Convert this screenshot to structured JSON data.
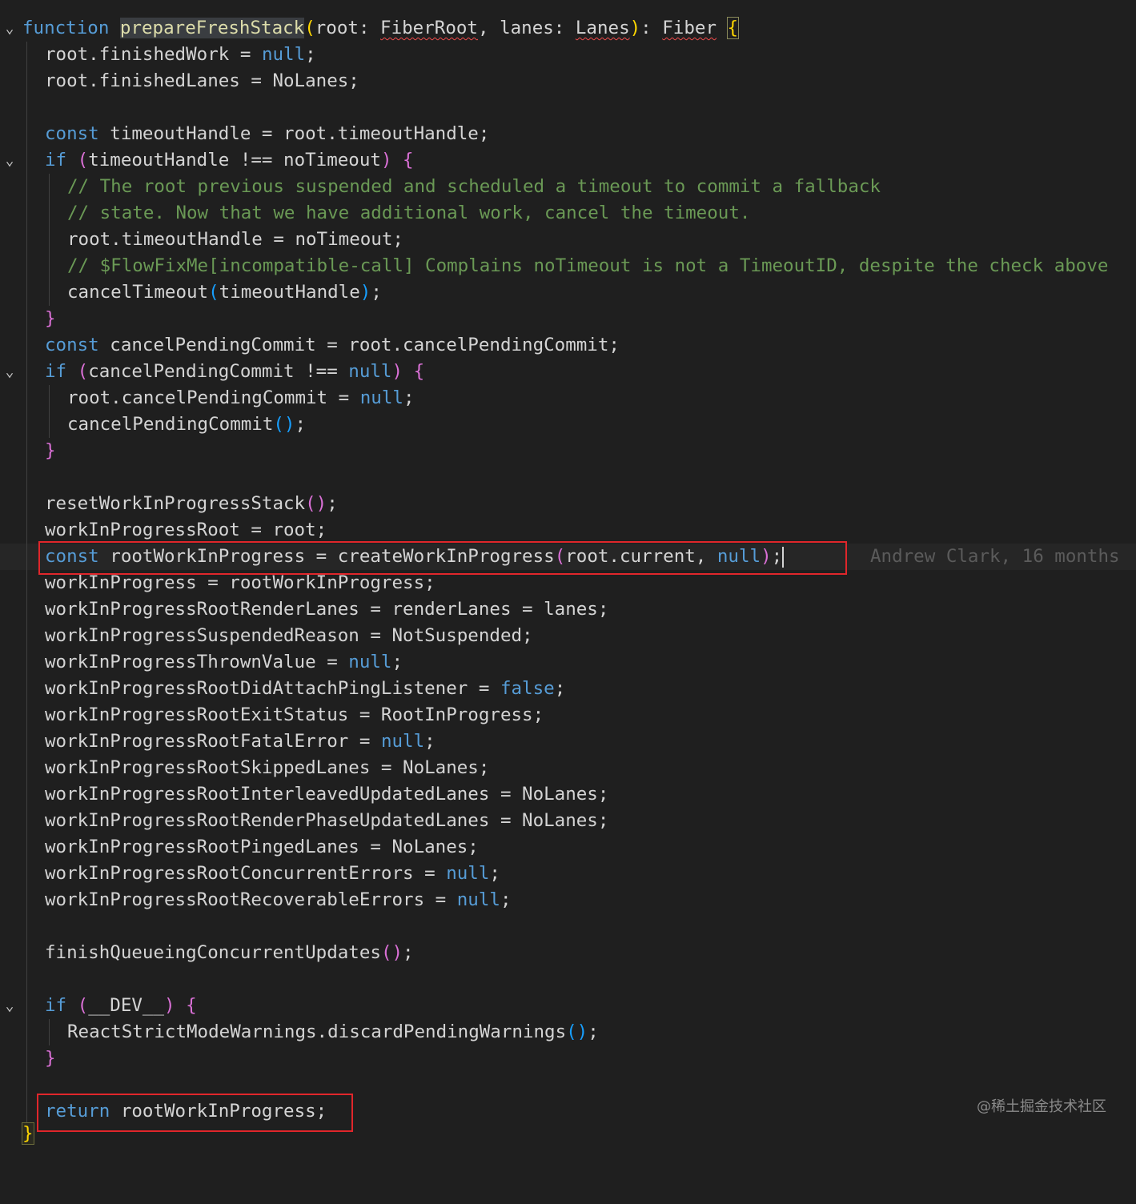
{
  "editor": {
    "lines": {
      "l1": {
        "kw": "function",
        "fn": "prepareFreshStack",
        "p1": "(",
        "a1": "root",
        "c1": ": ",
        "t1": "FiberRoot",
        "c2": ", ",
        "a2": "lanes",
        "c3": ": ",
        "t2": "Lanes",
        "p2": ")",
        "c4": ": ",
        "t3": "Fiber",
        "sp": " ",
        "b": "{"
      },
      "l2": {
        "t": "root.finishedWork = ",
        "n": "null",
        "e": ";"
      },
      "l3": {
        "t": "root.finishedLanes = NoLanes;"
      },
      "l5": {
        "kw": "const",
        "t": " timeoutHandle = root.timeoutHandle;"
      },
      "l6": {
        "kw": "if",
        "sp": " ",
        "p1": "(",
        "t": "timeoutHandle !== noTimeout",
        "p2": ")",
        "sp2": " ",
        "b": "{"
      },
      "l7": {
        "cm": "// The root previous suspended and scheduled a timeout to commit a fallback"
      },
      "l8": {
        "cm": "// state. Now that we have additional work, cancel the timeout."
      },
      "l9": {
        "t": "root.timeoutHandle = noTimeout;"
      },
      "l10": {
        "cm": "// $FlowFixMe[incompatible-call] Complains noTimeout is not a TimeoutID, despite the check above"
      },
      "l11": {
        "fn": "cancelTimeout",
        "p1": "(",
        "t": "timeoutHandle",
        "p2": ")",
        "e": ";"
      },
      "l12": {
        "b": "}"
      },
      "l13": {
        "kw": "const",
        "t": " cancelPendingCommit = root.cancelPendingCommit;"
      },
      "l14": {
        "kw": "if",
        "sp": " ",
        "p1": "(",
        "t": "cancelPendingCommit !== ",
        "n": "null",
        "p2": ")",
        "sp2": " ",
        "b": "{"
      },
      "l15": {
        "t": "root.cancelPendingCommit = ",
        "n": "null",
        "e": ";"
      },
      "l16": {
        "fn": "cancelPendingCommit",
        "p": "()",
        "e": ";"
      },
      "l17": {
        "b": "}"
      },
      "l19": {
        "fn": "resetWorkInProgressStack",
        "p": "()",
        "e": ";"
      },
      "l20": {
        "t": "workInProgressRoot = root;"
      },
      "l21": {
        "kw": "const",
        "t": " rootWorkInProgress = ",
        "fn": "createWorkInProgress",
        "p1": "(",
        "t2": "root.current, ",
        "n": "null",
        "p2": ")",
        "e": ";",
        "blame": "Andrew Clark, 16 months"
      },
      "l22": {
        "t": "workInProgress = rootWorkInProgress;"
      },
      "l23": {
        "t": "workInProgressRootRenderLanes = renderLanes = lanes;"
      },
      "l24": {
        "t": "workInProgressSuspendedReason = NotSuspended;"
      },
      "l25": {
        "t": "workInProgressThrownValue = ",
        "n": "null",
        "e": ";"
      },
      "l26": {
        "t": "workInProgressRootDidAttachPingListener = ",
        "n": "false",
        "e": ";"
      },
      "l27": {
        "t": "workInProgressRootExitStatus = RootInProgress;"
      },
      "l28": {
        "t": "workInProgressRootFatalError = ",
        "n": "null",
        "e": ";"
      },
      "l29": {
        "t": "workInProgressRootSkippedLanes = NoLanes;"
      },
      "l30": {
        "t": "workInProgressRootInterleavedUpdatedLanes = NoLanes;"
      },
      "l31": {
        "t": "workInProgressRootRenderPhaseUpdatedLanes = NoLanes;"
      },
      "l32": {
        "t": "workInProgressRootPingedLanes = NoLanes;"
      },
      "l33": {
        "t": "workInProgressRootConcurrentErrors = ",
        "n": "null",
        "e": ";"
      },
      "l34": {
        "t": "workInProgressRootRecoverableErrors = ",
        "n": "null",
        "e": ";"
      },
      "l36": {
        "fn": "finishQueueingConcurrentUpdates",
        "p": "()",
        "e": ";"
      },
      "l38": {
        "kw": "if",
        "sp": " ",
        "p1": "(",
        "t": "__DEV__",
        "p2": ")",
        "sp2": " ",
        "b": "{"
      },
      "l39": {
        "t": "ReactStrictModeWarnings.",
        "fn": "discardPendingWarnings",
        "p": "()",
        "e": ";"
      },
      "l40": {
        "b": "}"
      },
      "l42": {
        "kw": "return",
        "t": " rootWorkInProgress;"
      },
      "l43": {
        "b": "}"
      }
    },
    "fold_icon": "chevron-down-icon"
  },
  "watermark": "@稀土掘金技术社区",
  "colors": {
    "keyword": "#569cd6",
    "function": "#dcdcaa",
    "comment": "#6a9955",
    "highlight_box": "#e0262b",
    "background": "#1f1f1f"
  }
}
